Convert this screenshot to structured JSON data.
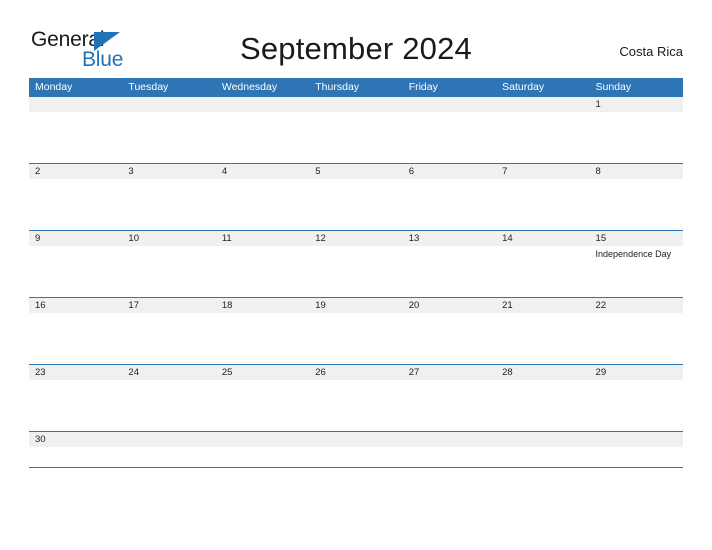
{
  "brand": {
    "logo_word_1": "General",
    "logo_word_2": "Blue",
    "logo_flag_icon": "triangle-flag-icon",
    "color_blue": "#2272b8"
  },
  "header": {
    "title": "September 2024",
    "locale": "Costa Rica"
  },
  "colors": {
    "header_bar": "#2e75b6",
    "date_strip": "#f0f0f0",
    "row_separator": "#2e75b6",
    "text": "#222222",
    "header_text": "#ffffff"
  },
  "calendar": {
    "weekdays": [
      "Monday",
      "Tuesday",
      "Wednesday",
      "Thursday",
      "Friday",
      "Saturday",
      "Sunday"
    ],
    "weeks": [
      {
        "days": [
          {
            "num": "",
            "event": ""
          },
          {
            "num": "",
            "event": ""
          },
          {
            "num": "",
            "event": ""
          },
          {
            "num": "",
            "event": ""
          },
          {
            "num": "",
            "event": ""
          },
          {
            "num": "",
            "event": ""
          },
          {
            "num": "1",
            "event": ""
          }
        ]
      },
      {
        "days": [
          {
            "num": "2",
            "event": ""
          },
          {
            "num": "3",
            "event": ""
          },
          {
            "num": "4",
            "event": ""
          },
          {
            "num": "5",
            "event": ""
          },
          {
            "num": "6",
            "event": ""
          },
          {
            "num": "7",
            "event": ""
          },
          {
            "num": "8",
            "event": ""
          }
        ]
      },
      {
        "days": [
          {
            "num": "9",
            "event": ""
          },
          {
            "num": "10",
            "event": ""
          },
          {
            "num": "11",
            "event": ""
          },
          {
            "num": "12",
            "event": ""
          },
          {
            "num": "13",
            "event": ""
          },
          {
            "num": "14",
            "event": ""
          },
          {
            "num": "15",
            "event": "Independence Day"
          }
        ]
      },
      {
        "days": [
          {
            "num": "16",
            "event": ""
          },
          {
            "num": "17",
            "event": ""
          },
          {
            "num": "18",
            "event": ""
          },
          {
            "num": "19",
            "event": ""
          },
          {
            "num": "20",
            "event": ""
          },
          {
            "num": "21",
            "event": ""
          },
          {
            "num": "22",
            "event": ""
          }
        ]
      },
      {
        "days": [
          {
            "num": "23",
            "event": ""
          },
          {
            "num": "24",
            "event": ""
          },
          {
            "num": "25",
            "event": ""
          },
          {
            "num": "26",
            "event": ""
          },
          {
            "num": "27",
            "event": ""
          },
          {
            "num": "28",
            "event": ""
          },
          {
            "num": "29",
            "event": ""
          }
        ]
      },
      {
        "days": [
          {
            "num": "30",
            "event": ""
          },
          {
            "num": "",
            "event": ""
          },
          {
            "num": "",
            "event": ""
          },
          {
            "num": "",
            "event": ""
          },
          {
            "num": "",
            "event": ""
          },
          {
            "num": "",
            "event": ""
          },
          {
            "num": "",
            "event": ""
          }
        ]
      }
    ]
  }
}
